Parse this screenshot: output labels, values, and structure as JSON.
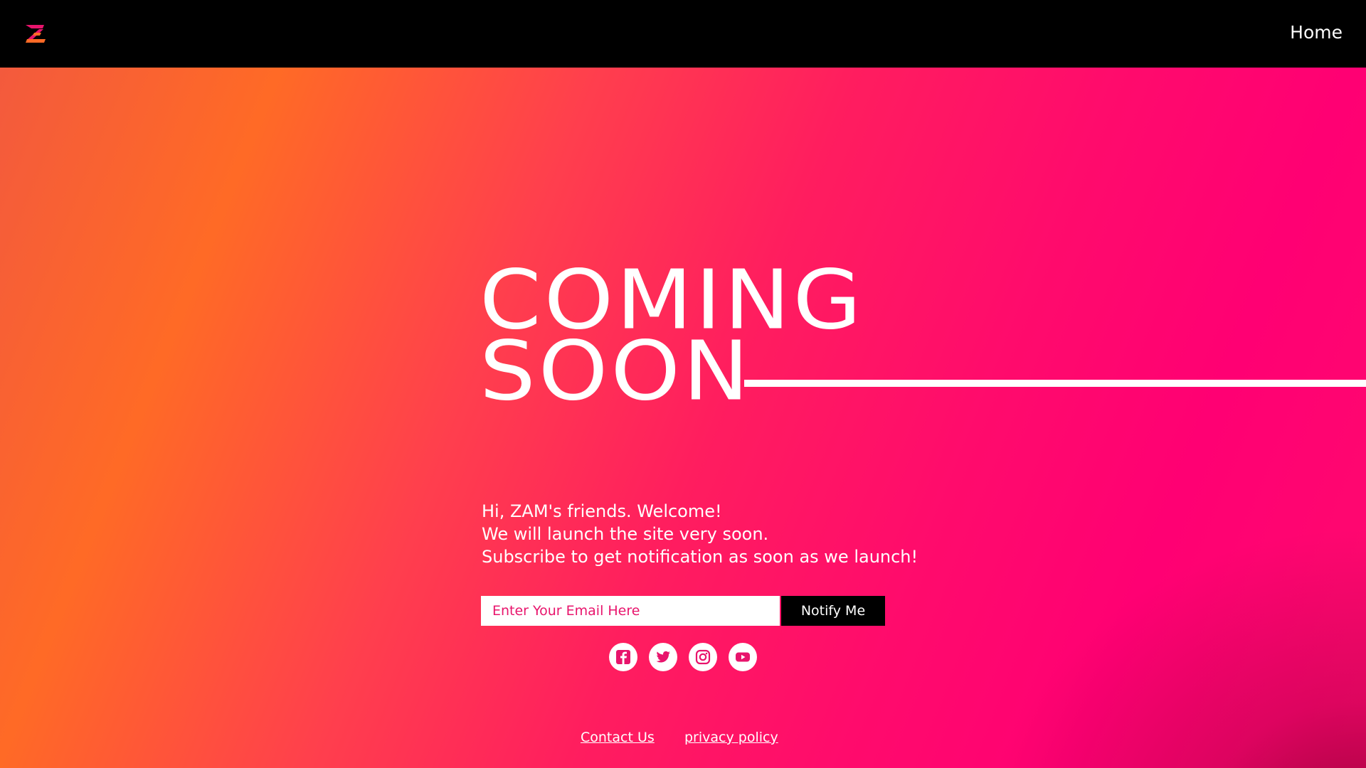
{
  "nav": {
    "home_label": "Home"
  },
  "hero": {
    "title_line1": "COMING",
    "title_line2": "SOON",
    "intro": [
      "Hi, ZAM's friends. Welcome!",
      "We will launch the site very soon.",
      "Subscribe to get notification as soon as we launch!"
    ]
  },
  "subscribe": {
    "email_placeholder": "Enter Your Email Here",
    "email_value": "",
    "button_label": "Notify Me"
  },
  "social": [
    "facebook-icon",
    "twitter-icon",
    "instagram-icon",
    "youtube-icon"
  ],
  "footer": {
    "contact_label": "Contact Us",
    "privacy_label": "privacy policy"
  },
  "colors": {
    "topbar": "#000000",
    "accent_pink": "#e8146c",
    "gradient_orange": "#ff6a26",
    "gradient_pink": "#ff0073",
    "button": "#000000",
    "text": "#ffffff"
  }
}
